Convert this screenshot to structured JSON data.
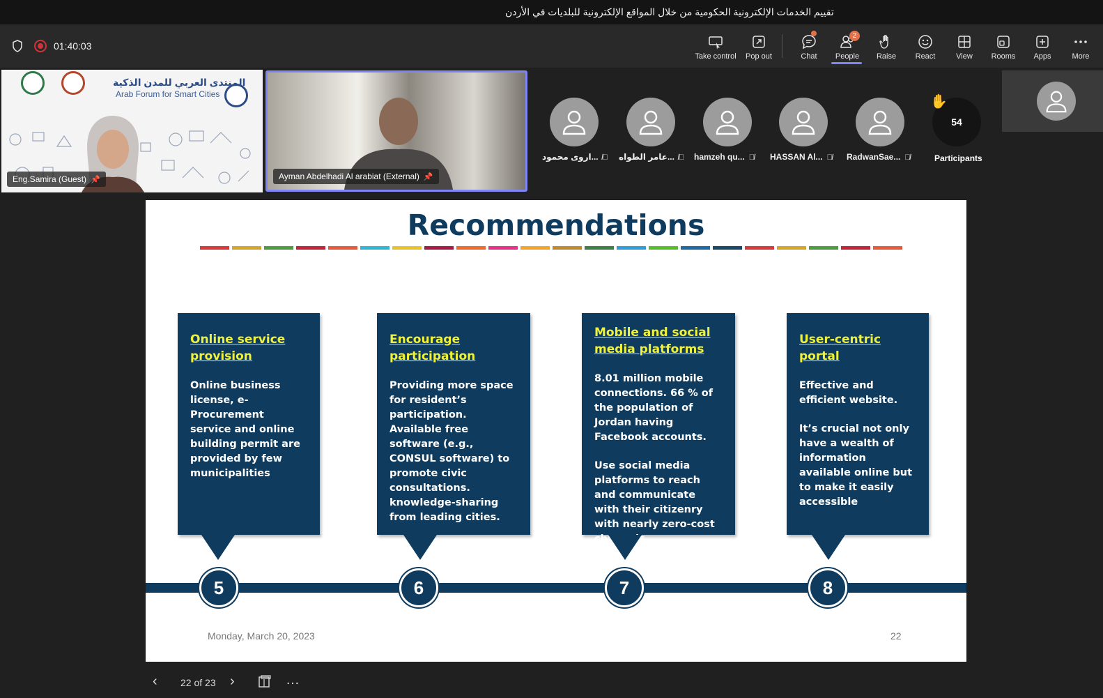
{
  "window": {
    "title": "تقييم الخدمات الإلكترونية الحكومية من خلال المواقع الإلكترونية للبلديات في الأردن"
  },
  "meeting": {
    "elapsed": "01:40:03"
  },
  "toolbar": {
    "take_control": "Take control",
    "pop_out": "Pop out",
    "chat": "Chat",
    "people": "People",
    "people_badge": "2",
    "raise": "Raise",
    "react": "React",
    "view": "View",
    "rooms": "Rooms",
    "apps": "Apps",
    "more": "More"
  },
  "video_tiles": [
    {
      "name": "Eng.Samira (Guest)",
      "org_ar": "المنتدى العربي للمدن الذكية",
      "org_en": "Arab Forum for Smart Cities"
    },
    {
      "name": "Ayman Abdelhadi Al arabiat (External)"
    }
  ],
  "participants": [
    {
      "name": "اروى محمود..."
    },
    {
      "name": "عامر الطواه..."
    },
    {
      "name": "hamzeh qu..."
    },
    {
      "name": "HASSAN Al..."
    },
    {
      "name": "RadwanSae..."
    }
  ],
  "participant_count": {
    "value": "54",
    "label": "Participants"
  },
  "slide": {
    "title": "Recommendations",
    "cards": [
      {
        "heading": "Online service provision",
        "body": [
          "Online business license, e-Procurement service and online building permit are provided by few municipalities"
        ],
        "step": "5"
      },
      {
        "heading": "Encourage participation",
        "body": [
          "Providing more space for resident’s participation. Available free software (e.g., CONSUL software) to promote civic consultations. knowledge-sharing from leading cities."
        ],
        "step": "6"
      },
      {
        "heading": "Mobile and social media platforms",
        "body": [
          "8.01 million mobile connections. 66 % of the population of Jordan having Facebook accounts.",
          "Use social media platforms to reach and communicate with their citizenry with nearly zero-cost channels."
        ],
        "step": "7"
      },
      {
        "heading": "User-centric portal",
        "body": [
          "Effective and efficient website.",
          "It’s  crucial not only have a wealth of information available online but to make it easily accessible"
        ],
        "step": "8"
      }
    ],
    "date": "Monday, March 20, 2023",
    "page_number": "22",
    "colorbar": [
      "#d9393b",
      "#d4a72c",
      "#4d9d3e",
      "#c5243a",
      "#e75a3a",
      "#33b5d4",
      "#e8c22a",
      "#a61c44",
      "#ef6b2d",
      "#e5338a",
      "#f2a628",
      "#bf8b2e",
      "#3f7e44",
      "#2f9fd8",
      "#56c02b",
      "#1d6aa5",
      "#19486a",
      "#d9393b",
      "#d4a72c",
      "#4d9d3e",
      "#c5243a",
      "#e75a3a"
    ]
  },
  "slide_nav": {
    "counter": "22 of 23"
  }
}
